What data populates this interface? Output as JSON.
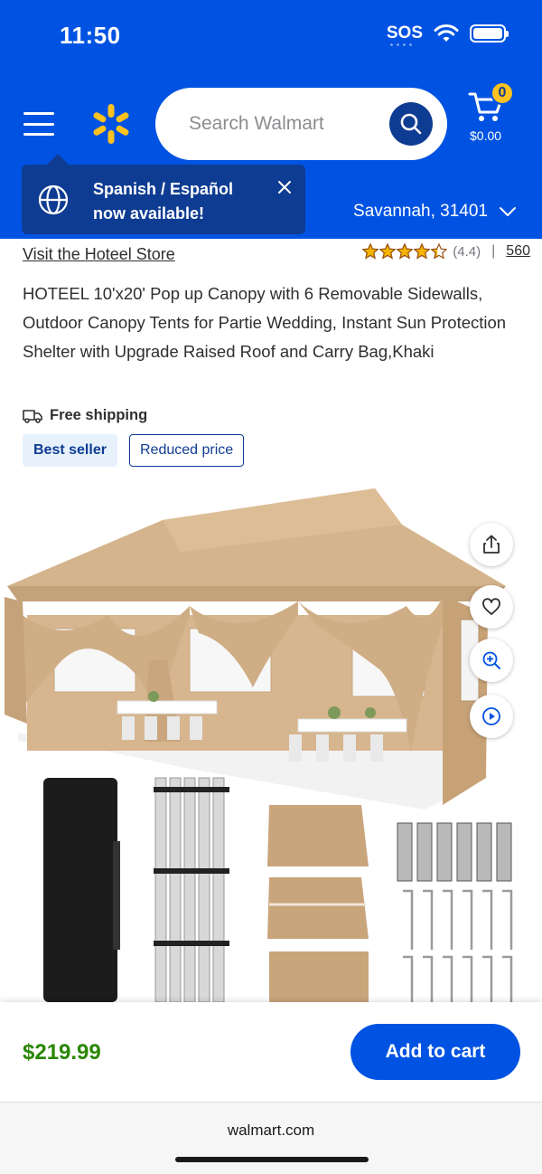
{
  "status_bar": {
    "time": "11:50",
    "sos": "SOS"
  },
  "header": {
    "search_placeholder": "Search Walmart",
    "cart_count": "0",
    "cart_total": "$0.00",
    "location": "Savannah, 31401"
  },
  "toast": {
    "line1": "Spanish / Español",
    "line2": "now available!"
  },
  "product": {
    "store_link": "Visit the Hoteel Store",
    "rating": "(4.4)",
    "rating_value": 4.4,
    "review_count": "560",
    "title": "HOTEEL 10'x20' Pop up Canopy with 6 Removable Sidewalls, Outdoor Canopy Tents for Partie Wedding, Instant Sun Protection Shelter with Upgrade Raised Roof and Carry Bag,Khaki",
    "shipping": "Free shipping",
    "badge_best": "Best seller",
    "badge_reduced": "Reduced price"
  },
  "footer": {
    "price": "$219.99",
    "add_to_cart": "Add to cart"
  },
  "browser": {
    "url": "walmart.com"
  },
  "colors": {
    "brand_blue": "#0053e2",
    "dark_blue": "#0e3c92",
    "spark_yellow": "#ffc220",
    "price_green": "#2a8703",
    "canopy_khaki": "#c9a77f"
  },
  "icons": {
    "menu": "hamburger-icon",
    "logo": "walmart-spark-icon",
    "search": "search-icon",
    "cart": "cart-icon",
    "globe": "globe-icon",
    "close": "close-icon",
    "chevron": "chevron-down-icon",
    "truck": "truck-icon",
    "share": "share-icon",
    "favorite": "heart-icon",
    "zoom": "zoom-in-icon",
    "video": "play-icon"
  }
}
